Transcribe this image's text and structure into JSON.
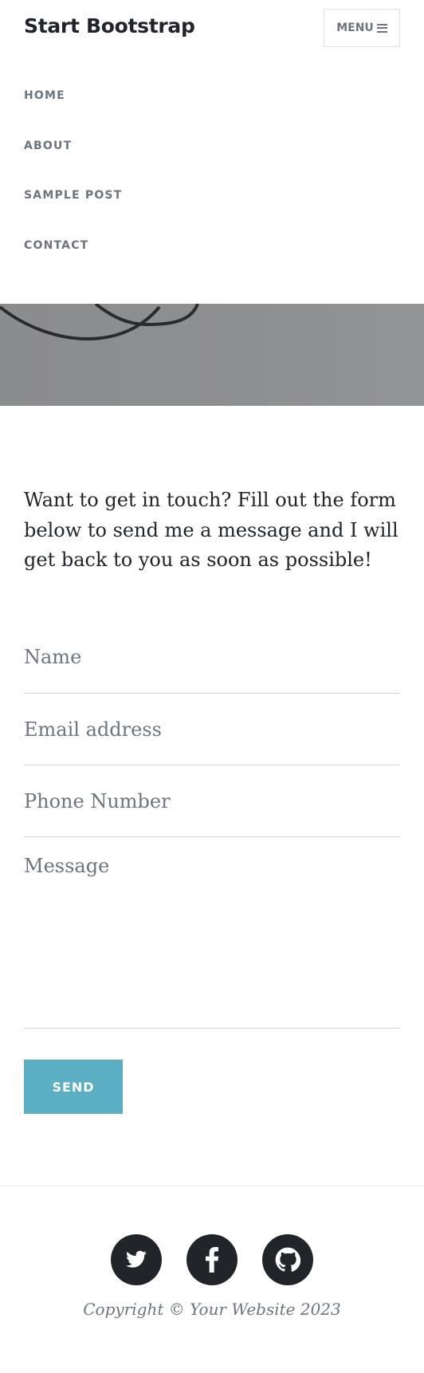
{
  "header": {
    "brand": "Start Bootstrap",
    "menu_label": "MENU",
    "nav_items": [
      "HOME",
      "ABOUT",
      "SAMPLE POST",
      "CONTACT"
    ]
  },
  "intro": "Want to get in touch? Fill out the form below to send me a message and I will get back to you as soon as possible!",
  "form": {
    "name_placeholder": "Name",
    "email_placeholder": "Email address",
    "phone_placeholder": "Phone Number",
    "message_placeholder": "Message",
    "send_label": "SEND"
  },
  "footer": {
    "social_icons": [
      "twitter-icon",
      "facebook-icon",
      "github-icon"
    ],
    "copyright": "Copyright © Your Website 2023"
  },
  "colors": {
    "send_button": "#5aafc4",
    "text": "#212529",
    "muted": "#6c757d"
  }
}
